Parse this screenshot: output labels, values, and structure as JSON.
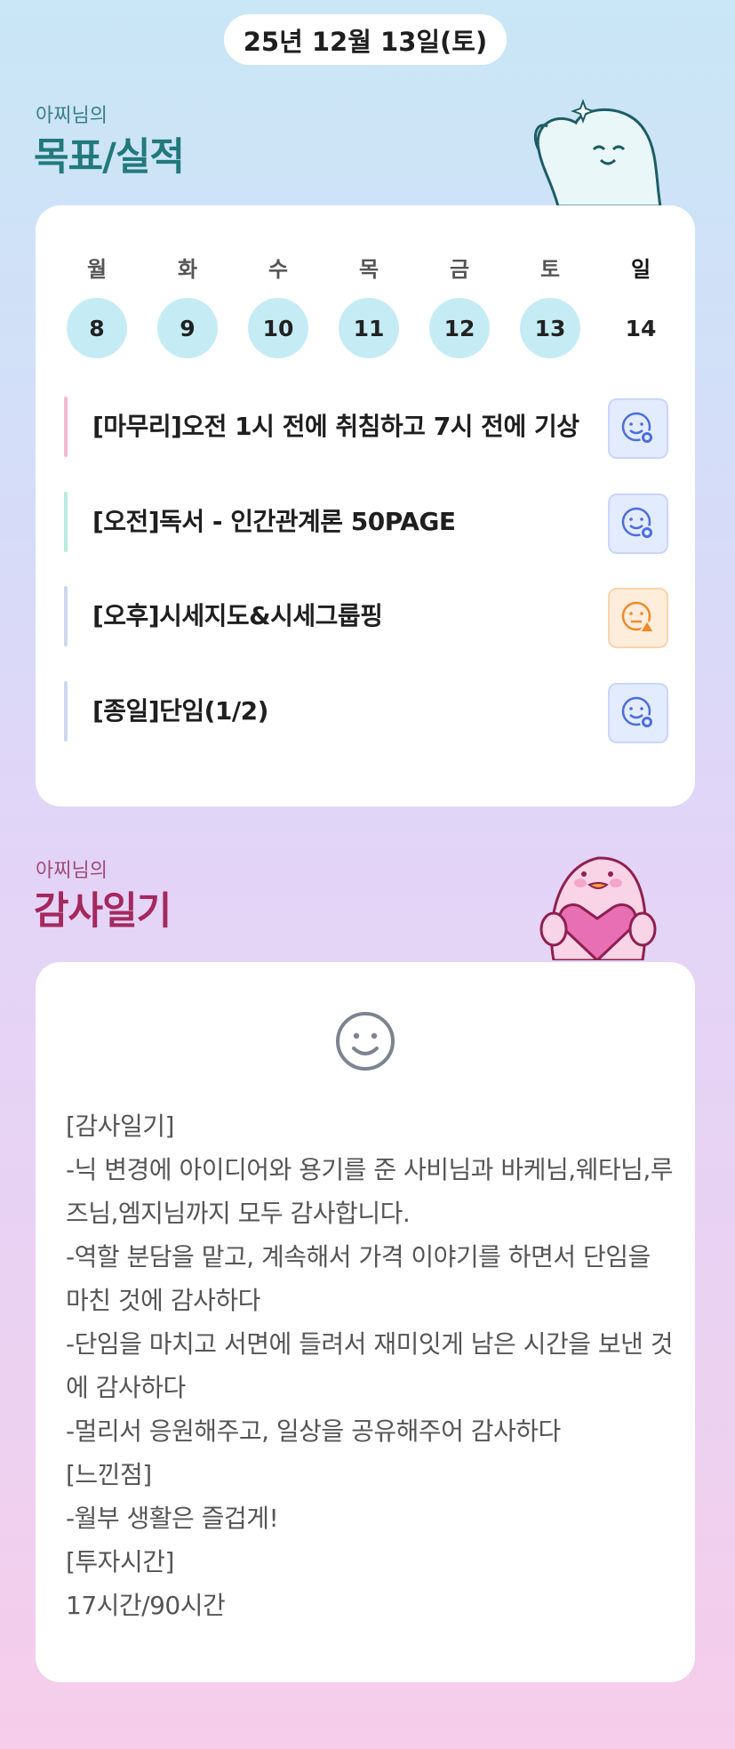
{
  "header": {
    "date": "25년 12월 13일(토)"
  },
  "goals_section": {
    "subtitle": "아찌님의",
    "title": "목표/실적",
    "title_color": "#22797c",
    "subtitle_color": "#3a7f86"
  },
  "week": {
    "days": [
      {
        "label": "월",
        "date": "8",
        "done": true
      },
      {
        "label": "화",
        "date": "9",
        "done": true
      },
      {
        "label": "수",
        "date": "10",
        "done": true
      },
      {
        "label": "목",
        "date": "11",
        "done": true
      },
      {
        "label": "금",
        "date": "12",
        "done": true
      },
      {
        "label": "토",
        "date": "13",
        "done": true
      },
      {
        "label": "일",
        "date": "14",
        "done": false
      }
    ]
  },
  "goals": [
    {
      "text": "[마무리]오전 1시 전에 취침하고 7시 전에 기상",
      "bar_color": "#f5b8d2",
      "status": "blue",
      "icon": "smile-check-icon"
    },
    {
      "text": "[오전]독서 - 인간관계론 50PAGE",
      "bar_color": "#b8ece0",
      "status": "blue",
      "icon": "smile-check-icon"
    },
    {
      "text": "[오후]시세지도&시세그룹핑",
      "bar_color": "#cfd7f0",
      "status": "orange",
      "icon": "face-warning-icon"
    },
    {
      "text": "[종일]단임(1/2)",
      "bar_color": "#cfd7f0",
      "status": "blue",
      "icon": "smile-check-icon"
    }
  ],
  "diary_section": {
    "subtitle": "아찌님의",
    "title": "감사일기",
    "title_color": "#a4285e",
    "subtitle_color": "#a04a78",
    "mood_icon": "smiley-face-icon",
    "body": "[감사일기]\n-닉 변경에 아이디어와 용기를 준 사비님과 바케님,웨타님,루즈님,엠지님까지 모두 감사합니다.\n-역할 분담을 맡고, 계속해서 가격 이야기를 하면서 단임을 마친 것에 감사하다\n-단임을 마치고 서면에 들려서 재미잇게 남은 시간을 보낸 것에 감사하다\n-멀리서 응원해주고, 일상을 공유해주어 감사하다\n[느낀점]\n-월부 생활은 즐겁게!\n[투자시간]\n17시간/90시간"
  }
}
